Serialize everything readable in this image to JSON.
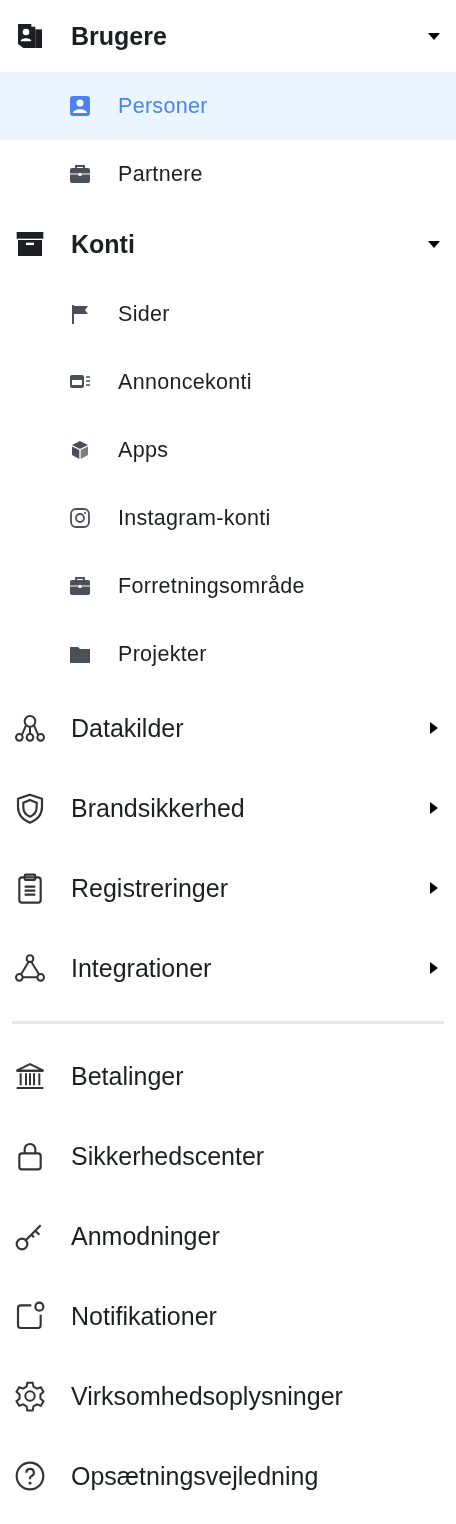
{
  "nav": [
    {
      "kind": "group",
      "label": "Brugere",
      "expanded": true,
      "children": [
        {
          "label": "Personer",
          "selected": true
        },
        {
          "label": "Partnere",
          "selected": false
        }
      ]
    },
    {
      "kind": "group",
      "label": "Konti",
      "expanded": true,
      "children": [
        {
          "label": "Sider",
          "selected": false
        },
        {
          "label": "Annoncekonti",
          "selected": false
        },
        {
          "label": "Apps",
          "selected": false
        },
        {
          "label": "Instagram-konti",
          "selected": false
        },
        {
          "label": "Forretningsområde",
          "selected": false
        },
        {
          "label": "Projekter",
          "selected": false
        }
      ]
    },
    {
      "kind": "group",
      "label": "Datakilder",
      "expanded": false
    },
    {
      "kind": "group",
      "label": "Brandsikkerhed",
      "expanded": false
    },
    {
      "kind": "group",
      "label": "Registreringer",
      "expanded": false
    },
    {
      "kind": "group",
      "label": "Integrationer",
      "expanded": false
    },
    {
      "kind": "divider"
    },
    {
      "kind": "item",
      "label": "Betalinger"
    },
    {
      "kind": "item",
      "label": "Sikkerhedscenter"
    },
    {
      "kind": "item",
      "label": "Anmodninger"
    },
    {
      "kind": "item",
      "label": "Notifikationer"
    },
    {
      "kind": "item",
      "label": "Virksomhedsoplysninger"
    },
    {
      "kind": "item",
      "label": "Opsætningsvejledning"
    }
  ]
}
